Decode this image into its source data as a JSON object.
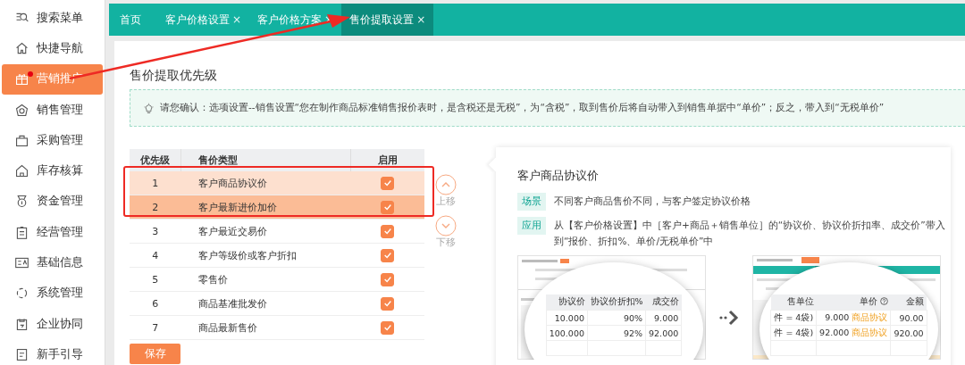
{
  "sidebar": {
    "items": [
      {
        "label": "搜索菜单",
        "selected": false,
        "dot": false
      },
      {
        "label": "快捷导航",
        "selected": false,
        "dot": false
      },
      {
        "label": "营销推广",
        "selected": true,
        "dot": true
      },
      {
        "label": "销售管理",
        "selected": false,
        "dot": false
      },
      {
        "label": "采购管理",
        "selected": false,
        "dot": false
      },
      {
        "label": "库存核算",
        "selected": false,
        "dot": false
      },
      {
        "label": "资金管理",
        "selected": false,
        "dot": false
      },
      {
        "label": "经营管理",
        "selected": false,
        "dot": false
      },
      {
        "label": "基础信息",
        "selected": false,
        "dot": false
      },
      {
        "label": "系统管理",
        "selected": false,
        "dot": false
      },
      {
        "label": "企业协同",
        "selected": false,
        "dot": false
      },
      {
        "label": "新手引导",
        "selected": false,
        "dot": false
      }
    ]
  },
  "tabs": [
    {
      "label": "首页",
      "selected": false,
      "closable": false
    },
    {
      "label": "客户价格设置",
      "selected": false,
      "closable": true
    },
    {
      "label": "客户价格方案",
      "selected": false,
      "closable": true
    },
    {
      "label": "售价提取设置",
      "selected": true,
      "closable": true
    }
  ],
  "close_glyph": "×",
  "page_title": "售价提取优先级",
  "tip": "请您确认：选项设置--销售设置“您在制作商品标准销售报价表时，是含税还是无税”，为“含税”，取到售价后将自动带入到销售单据中“单价”；反之，带入到“无税单价”",
  "table": {
    "columns": [
      "优先级",
      "售价类型",
      "启用"
    ],
    "rows": [
      {
        "priority": "1",
        "type": "客户商品协议价",
        "enabled": true,
        "selected": false,
        "hovered": true
      },
      {
        "priority": "2",
        "type": "客户最新进价加价",
        "enabled": true,
        "selected": true,
        "hovered": false
      },
      {
        "priority": "3",
        "type": "客户最近交易价",
        "enabled": true,
        "selected": false,
        "hovered": false
      },
      {
        "priority": "4",
        "type": "客户等级价或客户折扣",
        "enabled": true,
        "selected": false,
        "hovered": false
      },
      {
        "priority": "5",
        "type": "零售价",
        "enabled": true,
        "selected": false,
        "hovered": false
      },
      {
        "priority": "6",
        "type": "商品基准批发价",
        "enabled": true,
        "selected": false,
        "hovered": false
      },
      {
        "priority": "7",
        "type": "商品最新售价",
        "enabled": true,
        "selected": false,
        "hovered": false
      }
    ]
  },
  "move_up": "上移",
  "move_down": "下移",
  "save": "保存",
  "detail": {
    "title": "客户商品协议价",
    "sections": [
      {
        "tag": "场景",
        "text": "不同客户商品售价不同，与客户签定协议价格"
      },
      {
        "tag": "应用",
        "text": "从【客户价格设置】中［客户+商品＋销售单位］的“协议价、协议价折扣率、成交价”带入到“报价、折扣%、单价/无税单价”中"
      }
    ],
    "before": {
      "columns": [
        "协议价",
        "协议价折扣%",
        "成交价"
      ],
      "rows": [
        [
          "10.000",
          "90%",
          "9.000"
        ],
        [
          "100.000",
          "92%",
          "92.000"
        ]
      ]
    },
    "after": {
      "columns": [
        "售单位",
        "单价",
        "金额"
      ],
      "rows": [
        {
          "unit": "件 = 4袋)",
          "price": "9.000",
          "source": "商品协议",
          "amount": "90.00"
        },
        {
          "unit": "件 = 4袋)",
          "price": "92.000",
          "source": "商品协议",
          "amount": "920.00"
        }
      ]
    }
  }
}
